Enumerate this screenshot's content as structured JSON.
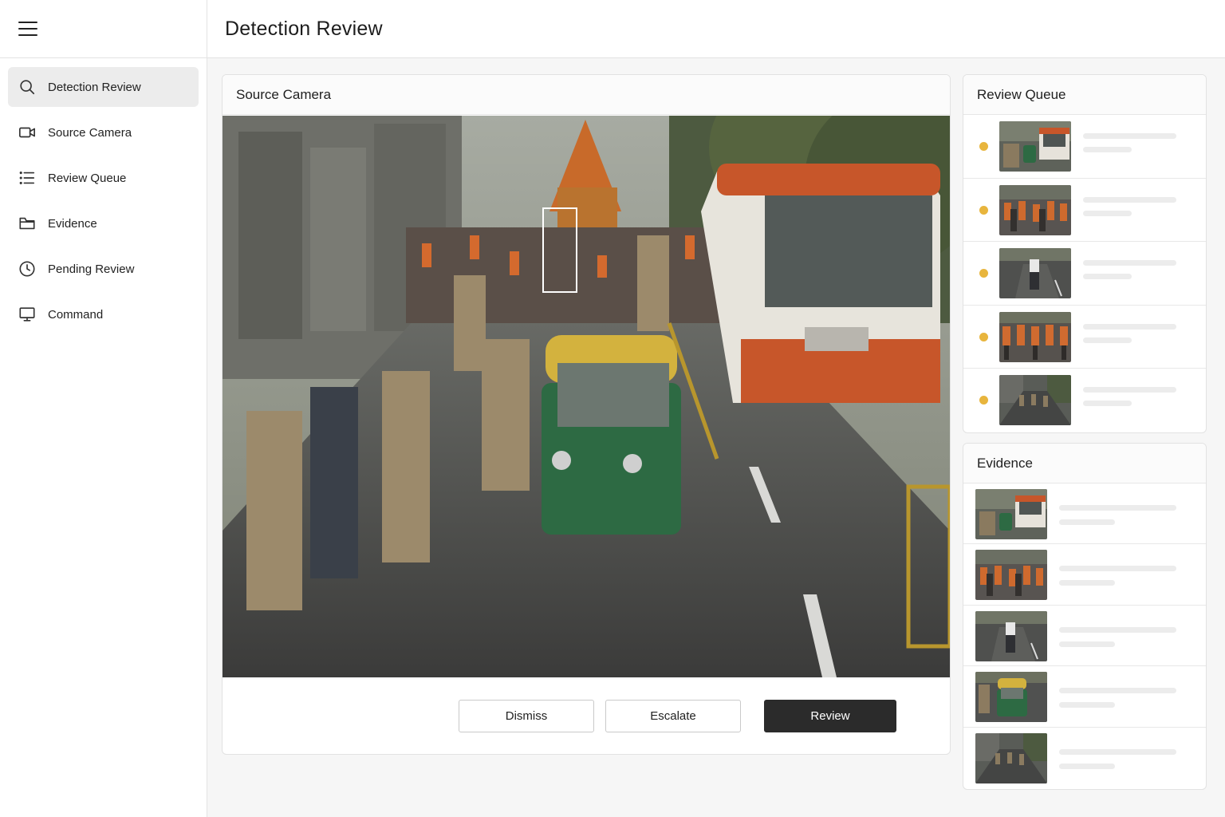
{
  "header": {
    "title": "Detection Review"
  },
  "sidebar": {
    "items": [
      {
        "label": "Detection Review",
        "icon": "search-icon",
        "active": true
      },
      {
        "label": "Source Camera",
        "icon": "video-camera-icon",
        "active": false
      },
      {
        "label": "Review Queue",
        "icon": "list-icon",
        "active": false
      },
      {
        "label": "Evidence",
        "icon": "folder-icon",
        "active": false
      },
      {
        "label": "Pending Review",
        "icon": "clock-icon",
        "active": false
      },
      {
        "label": "Command",
        "icon": "monitor-icon",
        "active": false
      }
    ]
  },
  "camera": {
    "title": "Source Camera"
  },
  "actions": {
    "dismiss": "Dismiss",
    "escalate": "Escalate",
    "review": "Review"
  },
  "queue": {
    "title": "Review Queue",
    "status_color": "#e8b53d",
    "items": [
      "bus-street-thumbnail",
      "crowd-orange-thumbnail",
      "motorcycle-thumbnail",
      "crowd-marching-thumbnail",
      "street-procession-thumbnail"
    ]
  },
  "evidence": {
    "title": "Evidence",
    "items": [
      "bus-street-thumbnail",
      "crowd-orange-thumbnail",
      "motorcycle-thumbnail",
      "autorickshaw-thumbnail",
      "street-procession-thumbnail"
    ]
  },
  "colors": {
    "accent_dark": "#2b2b2b",
    "sidebar_active": "#ececec"
  }
}
